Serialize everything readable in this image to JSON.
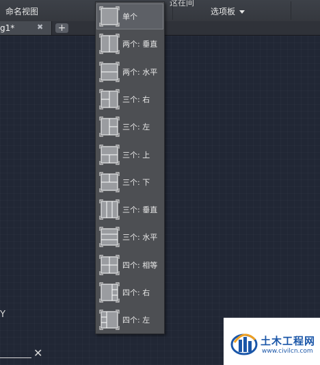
{
  "ribbon": {
    "named_view_label": "命名视图",
    "palette_label": "选项板",
    "hidden_tail_text": "这在间"
  },
  "tabs": {
    "document_tab_label": "g1*",
    "close_glyph": "✖",
    "new_tab_glyph": "+"
  },
  "canvas": {
    "ucs_y_label": "Y",
    "ucs_x_label": "✕"
  },
  "viewport_menu": {
    "selected_index": 0,
    "items": [
      {
        "label": "单个",
        "icon": "viewport-single-icon"
      },
      {
        "label": "两个: 垂直",
        "icon": "viewport-two-vertical-icon"
      },
      {
        "label": "两个: 水平",
        "icon": "viewport-two-horizontal-icon"
      },
      {
        "label": "三个: 右",
        "icon": "viewport-three-right-icon"
      },
      {
        "label": "三个: 左",
        "icon": "viewport-three-left-icon"
      },
      {
        "label": "三个: 上",
        "icon": "viewport-three-above-icon"
      },
      {
        "label": "三个: 下",
        "icon": "viewport-three-below-icon"
      },
      {
        "label": "三个: 垂直",
        "icon": "viewport-three-vertical-icon"
      },
      {
        "label": "三个: 水平",
        "icon": "viewport-three-horizontal-icon"
      },
      {
        "label": "四个: 相等",
        "icon": "viewport-four-equal-icon"
      },
      {
        "label": "四个: 右",
        "icon": "viewport-four-right-icon"
      },
      {
        "label": "四个: 左",
        "icon": "viewport-four-left-icon"
      }
    ]
  },
  "watermark": {
    "name": "土木工程网",
    "url": "www.civilcn.com",
    "logo_icon": "civilcn-logo-icon"
  },
  "colors": {
    "canvas_bg": "#212735",
    "menu_bg": "#4d4f53",
    "watermark_blue": "#1a56a8"
  }
}
